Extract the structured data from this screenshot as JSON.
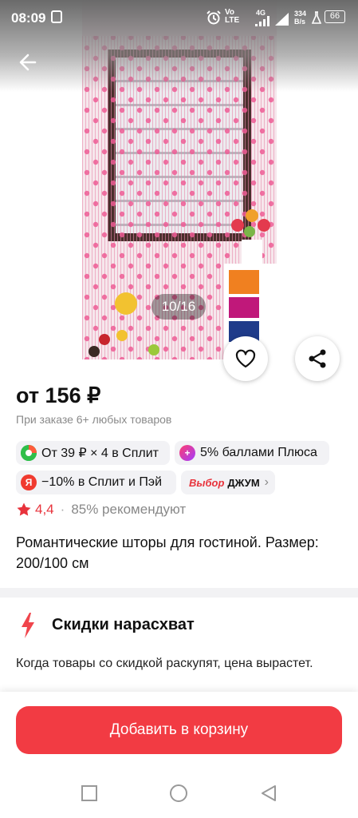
{
  "status_bar": {
    "time": "08:09",
    "network_label": "Vo LTE",
    "network_type": "4G",
    "speed": "334 B/s",
    "battery": "66"
  },
  "gallery": {
    "counter": "10/16"
  },
  "product": {
    "price": "от 156 ₽",
    "price_note": "При заказе 6+ любых товаров",
    "badges": {
      "split": "От 39 ₽ × 4 в Сплит",
      "plus": "5% баллами Плюса",
      "pay": "−10% в Сплит и Пэй",
      "choice_brand": "Выбор",
      "choice_name": "ДЖУМ"
    },
    "rating": "4,4",
    "recommend": "85% рекомендуют",
    "title": "Романтические шторы для гостиной. Размер: 200/100 см"
  },
  "sale_block": {
    "heading": "Скидки нарасхват",
    "text": "Когда товары со скидкой раскупят, цена вырастет."
  },
  "cart_button": {
    "label": "Добавить в корзину"
  },
  "colors": {
    "accent_red": "#f23b43",
    "star": "#e8333c"
  }
}
